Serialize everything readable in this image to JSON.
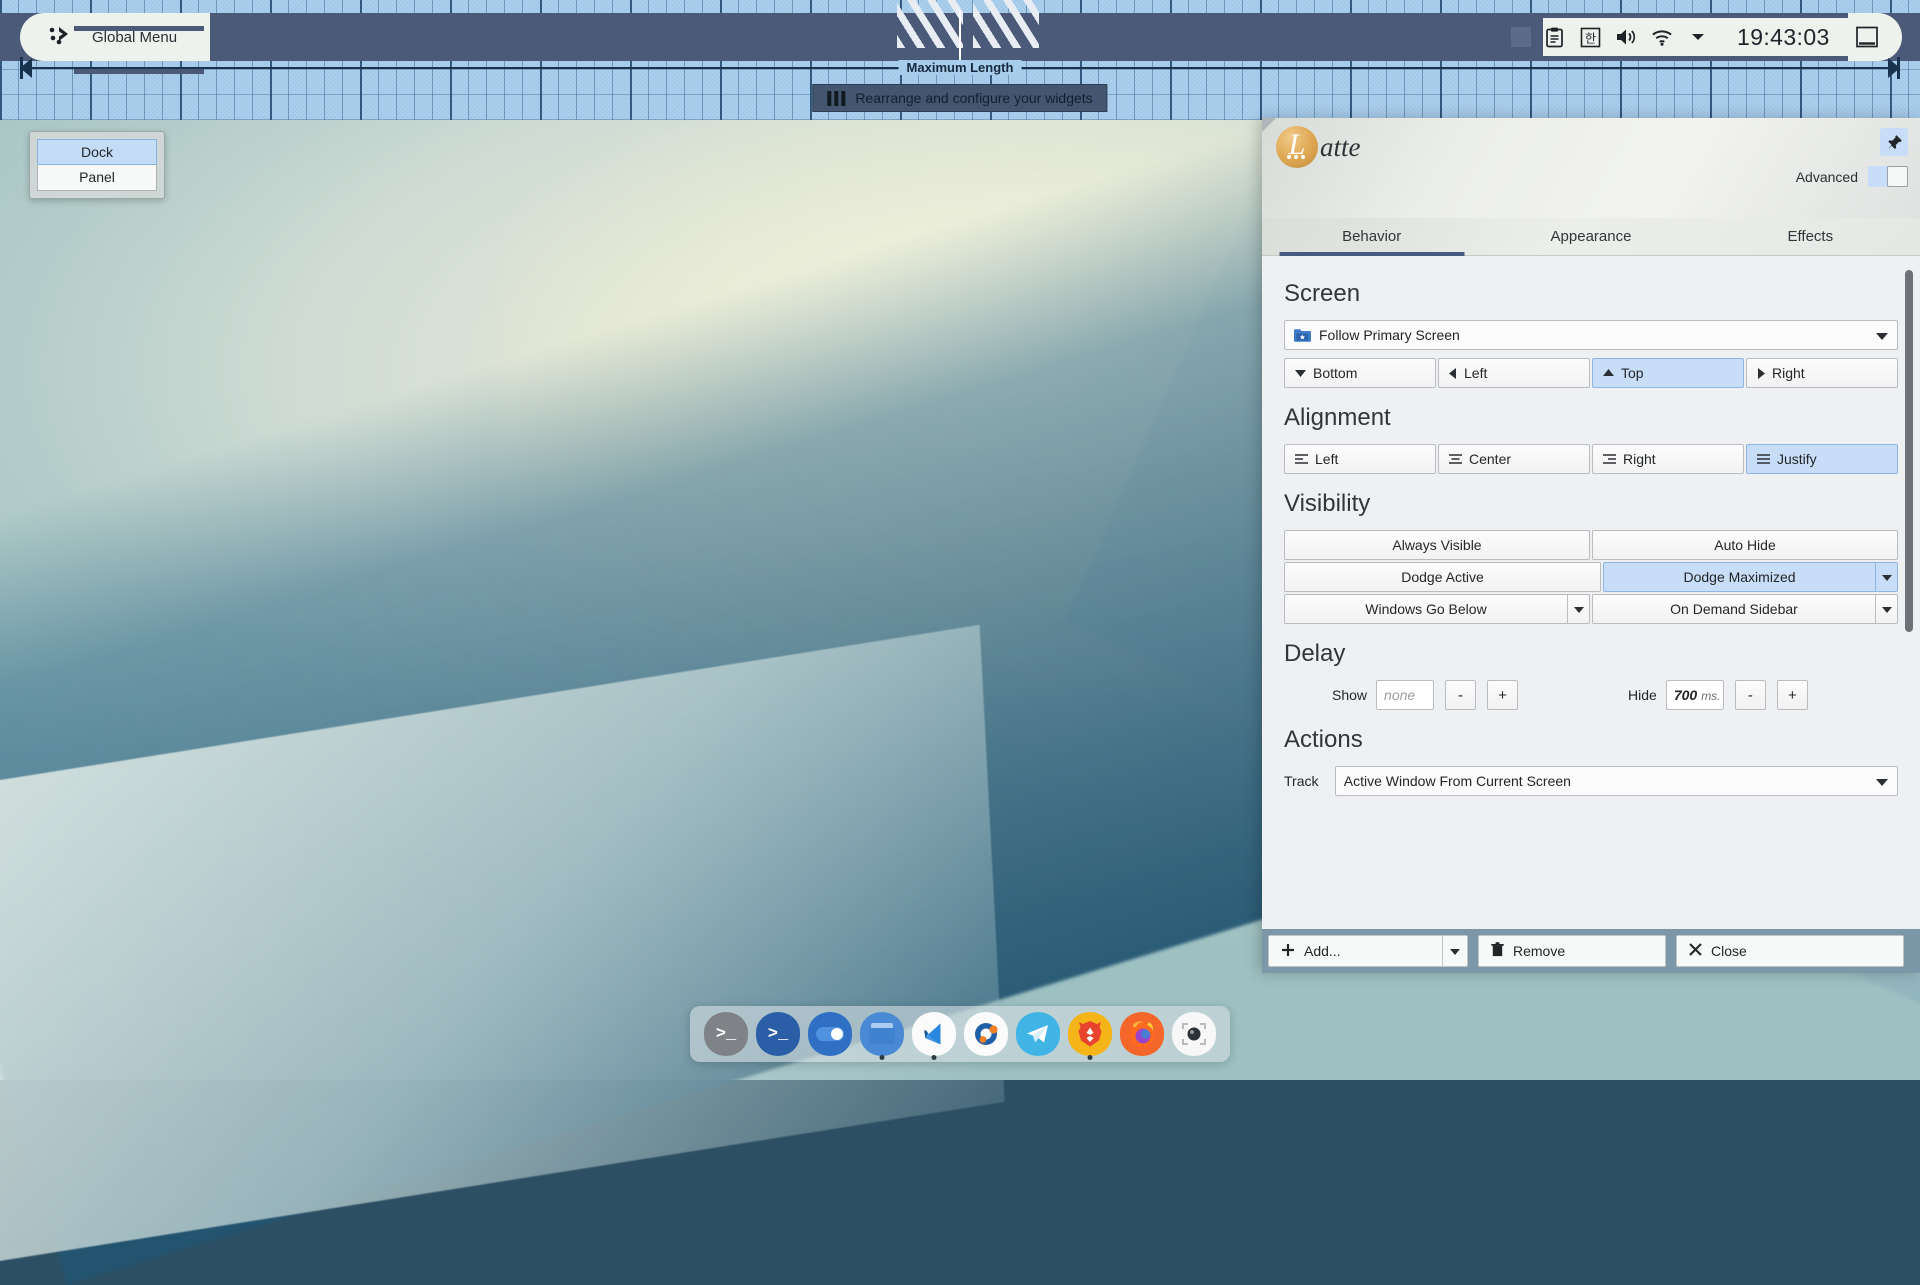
{
  "desktop": {
    "type_popup": {
      "options": [
        {
          "label": "Dock",
          "selected": true
        },
        {
          "label": "Panel",
          "selected": false
        }
      ]
    },
    "dock": {
      "items": [
        {
          "name": "terminal-gray",
          "running": false
        },
        {
          "name": "terminal-blue",
          "running": false
        },
        {
          "name": "system-settings",
          "running": false
        },
        {
          "name": "file-manager",
          "running": true
        },
        {
          "name": "vscode",
          "running": true
        },
        {
          "name": "qt-creator",
          "running": false
        },
        {
          "name": "telegram",
          "running": false
        },
        {
          "name": "brave",
          "running": true
        },
        {
          "name": "firefox",
          "running": false
        },
        {
          "name": "screenshot",
          "running": false
        }
      ]
    }
  },
  "panel": {
    "global_menu_label": "Global Menu",
    "maximum_length_label": "Maximum Length",
    "widgets_tooltip": "Rearrange and configure your widgets",
    "tray": {
      "icons": [
        "clipboard-icon",
        "input-method-korean-icon",
        "volume-icon",
        "wifi-icon",
        "chevron-down-icon"
      ],
      "input_method_text": "한",
      "clock": "19:43:03",
      "show_desktop": "show-desktop-icon"
    }
  },
  "latte": {
    "app_name_initial": "L",
    "app_name_rest": "atte",
    "pin_icon": "pin-icon",
    "advanced_label": "Advanced",
    "advanced_enabled": false,
    "tabs": [
      {
        "label": "Behavior",
        "active": true
      },
      {
        "label": "Appearance",
        "active": false
      },
      {
        "label": "Effects",
        "active": false
      }
    ],
    "screen": {
      "title": "Screen",
      "selected_screen": "Follow Primary Screen",
      "screen_icon": "primary-screen-folder-icon",
      "positions": [
        {
          "label": "Bottom",
          "icon": "arrow-down-icon",
          "selected": false
        },
        {
          "label": "Left",
          "icon": "arrow-left-icon",
          "selected": false
        },
        {
          "label": "Top",
          "icon": "arrow-up-icon",
          "selected": true
        },
        {
          "label": "Right",
          "icon": "arrow-right-icon",
          "selected": false
        }
      ]
    },
    "alignment": {
      "title": "Alignment",
      "options": [
        {
          "label": "Left",
          "icon": "align-left-icon",
          "selected": false
        },
        {
          "label": "Center",
          "icon": "align-center-icon",
          "selected": false
        },
        {
          "label": "Right",
          "icon": "align-right-icon",
          "selected": false
        },
        {
          "label": "Justify",
          "icon": "align-justify-icon",
          "selected": true
        }
      ]
    },
    "visibility": {
      "title": "Visibility",
      "options": [
        {
          "label": "Always Visible",
          "selected": false,
          "has_menu": false
        },
        {
          "label": "Auto Hide",
          "selected": false,
          "has_menu": false
        },
        {
          "label": "Dodge Active",
          "selected": false,
          "has_menu": false
        },
        {
          "label": "Dodge Maximized",
          "selected": true,
          "has_menu": true
        },
        {
          "label": "Windows Go Below",
          "selected": false,
          "has_menu": true
        },
        {
          "label": "On Demand Sidebar",
          "selected": false,
          "has_menu": true
        }
      ]
    },
    "delay": {
      "title": "Delay",
      "show_label": "Show",
      "show_value": "",
      "show_placeholder": "none",
      "hide_label": "Hide",
      "hide_value": "700",
      "hide_unit": "ms.",
      "minus_label": "-",
      "plus_label": "+"
    },
    "actions": {
      "title": "Actions",
      "track_label": "Track",
      "track_value": "Active Window From Current Screen"
    },
    "footer": {
      "add_label": "Add...",
      "add_icon": "plus-icon",
      "remove_label": "Remove",
      "remove_icon": "trash-icon",
      "close_label": "Close",
      "close_icon": "close-x-icon"
    }
  },
  "colors": {
    "accent_selection": "#c8ddf7",
    "tab_underline": "#475a80",
    "panel_bar": "#4a5a78",
    "edit_grid": "#a8cdec",
    "footer_bar": "#7c97a8"
  }
}
